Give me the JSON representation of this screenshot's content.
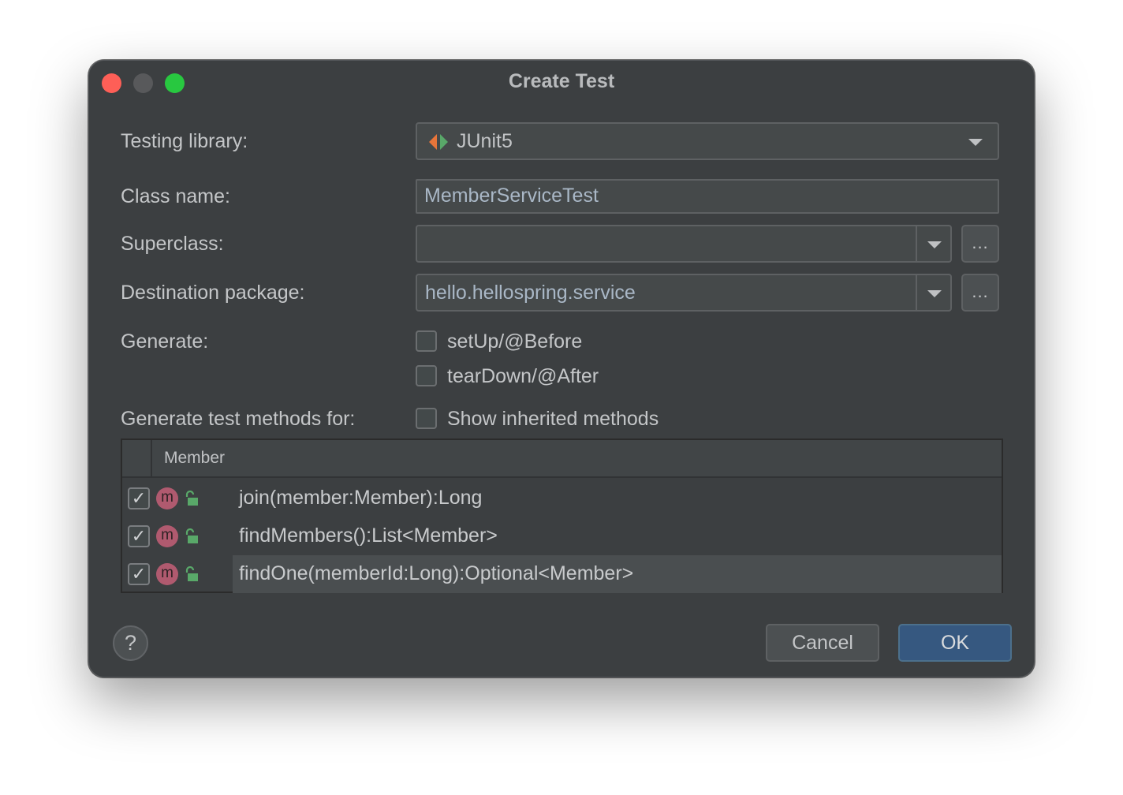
{
  "window": {
    "title": "Create Test"
  },
  "form": {
    "testing_library": {
      "label": "Testing library:",
      "value": "JUnit5"
    },
    "class_name": {
      "label": "Class name:",
      "value": "MemberServiceTest"
    },
    "superclass": {
      "label": "Superclass:",
      "value": "",
      "browse_label": "..."
    },
    "destination_package": {
      "label": "Destination package:",
      "value": "hello.hellospring.service",
      "browse_label": "..."
    },
    "generate": {
      "label": "Generate:",
      "options": [
        {
          "label": "setUp/@Before",
          "checked": false
        },
        {
          "label": "tearDown/@After",
          "checked": false
        }
      ]
    },
    "generate_methods": {
      "label": "Generate test methods for:",
      "show_inherited": {
        "label": "Show inherited methods",
        "checked": false
      }
    }
  },
  "members_table": {
    "header": "Member",
    "rows": [
      {
        "text": "join(member:Member):Long",
        "checked": true,
        "icon_letter": "m",
        "selected": false
      },
      {
        "text": "findMembers():List<Member>",
        "checked": true,
        "icon_letter": "m",
        "selected": false
      },
      {
        "text": "findOne(memberId:Long):Optional<Member>",
        "checked": true,
        "icon_letter": "m",
        "selected": true
      }
    ]
  },
  "footer": {
    "help_label": "?",
    "cancel_label": "Cancel",
    "ok_label": "OK"
  },
  "colors": {
    "dialog_bg": "#3c3f41",
    "ok_button": "#365880",
    "method_icon": "#b05a6f",
    "lock_icon": "#59a869"
  },
  "icons": {
    "junit": "junit-icon",
    "method": "method-icon",
    "public": "lock-open-icon",
    "check": "check-icon"
  }
}
